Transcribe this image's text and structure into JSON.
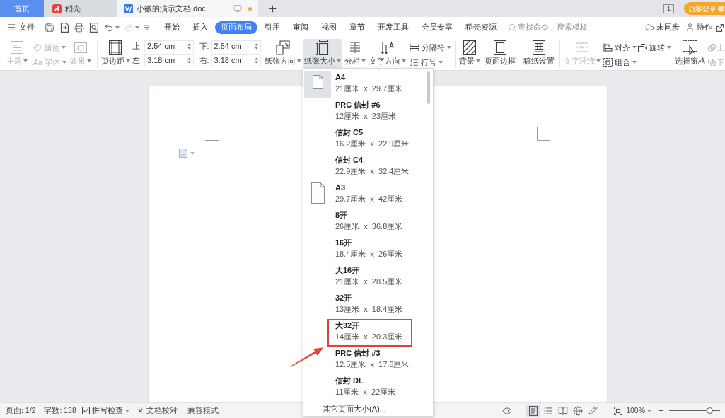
{
  "tabs": [
    {
      "label": "首页",
      "kind": "home",
      "selected": false
    },
    {
      "label": "稻壳",
      "kind": "docer",
      "selected": false
    },
    {
      "label": "小徽的演示文档.doc",
      "kind": "document",
      "selected": true,
      "unsaved": true
    }
  ],
  "title_bar": {
    "window_count": "1",
    "login_button": "访客登录"
  },
  "menu_bar": {
    "file": "文件",
    "redo_disabled": true,
    "tabs": [
      {
        "label": "开始",
        "selected": false
      },
      {
        "label": "插入",
        "selected": false
      },
      {
        "label": "页面布局",
        "selected": true
      },
      {
        "label": "引用",
        "selected": false
      },
      {
        "label": "审阅",
        "selected": false
      },
      {
        "label": "视图",
        "selected": false
      },
      {
        "label": "章节",
        "selected": false
      },
      {
        "label": "开发工具",
        "selected": false
      },
      {
        "label": "会员专享",
        "selected": false
      },
      {
        "label": "稻壳资源",
        "selected": false
      }
    ],
    "search": {
      "placeholder": "查找命令、搜索模板"
    },
    "sync": "未同步",
    "collaborate": "协作"
  },
  "ribbon": {
    "theme": {
      "label": "主题",
      "dropdown": true,
      "disabled": true
    },
    "colors": {
      "label": "颜色",
      "dropdown": true,
      "disabled": true
    },
    "fonts": {
      "glyph": "Aa",
      "label": "字体",
      "dropdown": true,
      "disabled": true
    },
    "effects": {
      "label": "效果",
      "dropdown": true,
      "disabled": true
    },
    "margins": {
      "label": "页边距",
      "dropdown": true,
      "fields": [
        {
          "label": "上:",
          "value": "2.54 cm"
        },
        {
          "label": "下:",
          "value": "2.54 cm"
        },
        {
          "label": "左:",
          "value": "3.18 cm"
        },
        {
          "label": "右:",
          "value": "3.18 cm"
        }
      ]
    },
    "orientation": {
      "label": "纸张方向",
      "dropdown": true
    },
    "paper_size": {
      "label": "纸张大小",
      "dropdown": true,
      "pressed": true
    },
    "columns": {
      "label": "分栏",
      "dropdown": true
    },
    "text_direction": {
      "label": "文字方向",
      "dropdown": true
    },
    "breaks": {
      "label": "分隔符",
      "dropdown": true
    },
    "line_numbers": {
      "label": "行号",
      "dropdown": true
    },
    "background": {
      "label": "背景",
      "dropdown": true
    },
    "page_border": {
      "label": "页面边框",
      "dropdown": false
    },
    "manuscript": {
      "label": "稿纸设置",
      "dropdown": false
    },
    "wrap_text": {
      "label": "文字环绕",
      "dropdown": true,
      "disabled": true
    },
    "align": {
      "label": "对齐",
      "dropdown": true
    },
    "rotate": {
      "label": "旋转",
      "dropdown": true
    },
    "group": {
      "label": "组合",
      "dropdown": true
    },
    "selection_pane": {
      "label": "选择窗格",
      "dropdown": false
    },
    "bring_forward": {
      "label": "上",
      "dropdown": false,
      "disabled": true
    },
    "send_backward": {
      "label": "下",
      "dropdown": false,
      "disabled": true
    }
  },
  "paper_size_menu": {
    "items": [
      {
        "name": "A4",
        "size": "21厘米 x 29.7厘米",
        "kind": "icon_small",
        "selected": true,
        "highlighted": false
      },
      {
        "name": "PRC 信封 #6",
        "size": "12厘米 x 23厘米",
        "kind": "plain",
        "selected": false,
        "highlighted": false
      },
      {
        "name": "信封 C5",
        "size": "16.2厘米 x 22.9厘米",
        "kind": "plain",
        "selected": false,
        "highlighted": false
      },
      {
        "name": "信封 C4",
        "size": "22.9厘米 x 32.4厘米",
        "kind": "plain",
        "selected": false,
        "highlighted": false
      },
      {
        "name": "A3",
        "size": "29.7厘米 x 42厘米",
        "kind": "icon_large",
        "selected": false,
        "highlighted": false
      },
      {
        "name": "8开",
        "size": "26厘米 x 36.8厘米",
        "kind": "plain",
        "selected": false,
        "highlighted": false
      },
      {
        "name": "16开",
        "size": "18.4厘米 x 26厘米",
        "kind": "plain",
        "selected": false,
        "highlighted": false
      },
      {
        "name": "大16开",
        "size": "21厘米 x 28.5厘米",
        "kind": "plain",
        "selected": false,
        "highlighted": false
      },
      {
        "name": "32开",
        "size": "13厘米 x 18.4厘米",
        "kind": "plain",
        "selected": false,
        "highlighted": false
      },
      {
        "name": "大32开",
        "size": "14厘米 x 20.3厘米",
        "kind": "plain",
        "selected": false,
        "highlighted": true
      },
      {
        "name": "PRC 信封 #3",
        "size": "12.5厘米 x 17.6厘米",
        "kind": "plain",
        "selected": false,
        "highlighted": false
      },
      {
        "name": "信封 DL",
        "size": "11厘米 x 22厘米",
        "kind": "plain",
        "selected": false,
        "highlighted": false
      }
    ],
    "more": "其它页面大小(A)..."
  },
  "status_bar": {
    "page": "页面: 1/2",
    "words": "字数: 138",
    "spell_check": {
      "label": "拼写检查",
      "dropdown": true
    },
    "proofread": "文档校对",
    "mode": "兼容模式",
    "view_modes": [
      {
        "selected": true
      },
      {
        "selected": false
      },
      {
        "selected": false
      },
      {
        "selected": false
      },
      {
        "selected": false
      }
    ],
    "zoom": {
      "label": "100%",
      "dropdown": true
    },
    "zoom_slider": {
      "level": 0.8
    }
  }
}
